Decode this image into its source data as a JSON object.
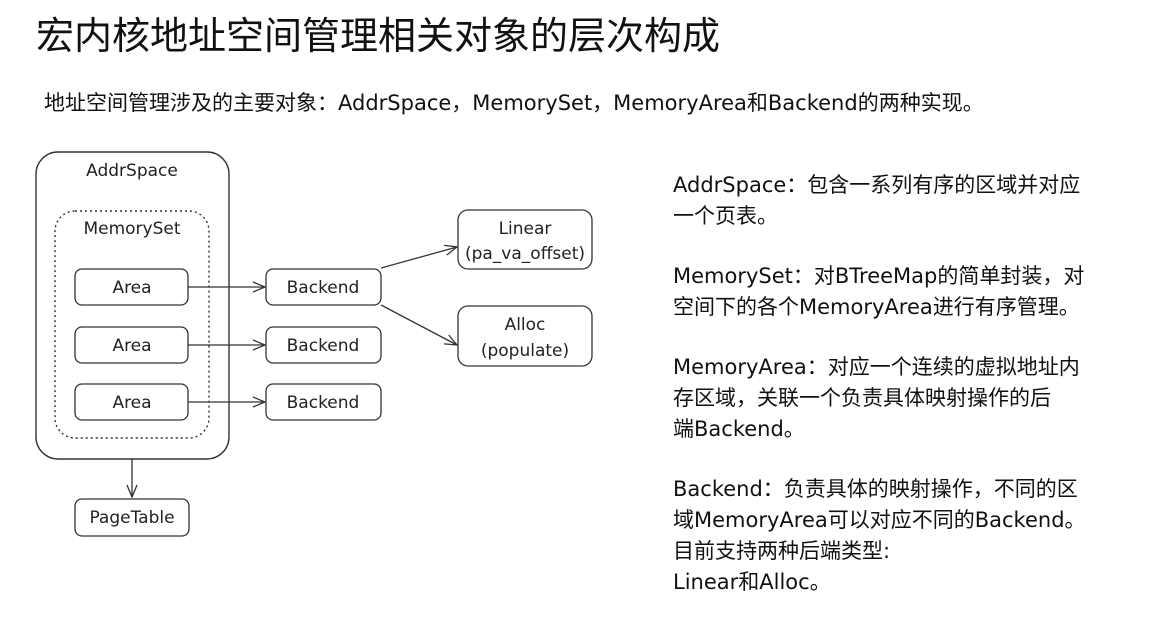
{
  "title": "宏内核地址空间管理相关对象的层次构成",
  "subtitle": "地址空间管理涉及的主要对象：AddrSpace，MemorySet，MemoryArea和Backend的两种实现。",
  "diagram": {
    "addrspace_label": "AddrSpace",
    "memoryset_label": "MemorySet",
    "areas": [
      "Area",
      "Area",
      "Area"
    ],
    "backends": [
      "Backend",
      "Backend",
      "Backend"
    ],
    "linear": {
      "line1": "Linear",
      "line2": "(pa_va_offset)"
    },
    "alloc": {
      "line1": "Alloc",
      "line2": "(populate)"
    },
    "pagetable_label": "PageTable"
  },
  "descriptions": [
    {
      "lines": [
        "AddrSpace：包含一系列有序的区域并对应",
        "一个页表。"
      ]
    },
    {
      "lines": [
        "MemorySet：对BTreeMap的简单封装，对",
        "空间下的各个MemoryArea进行有序管理。"
      ]
    },
    {
      "lines": [
        "MemoryArea：对应一个连续的虚拟地址内",
        "存区域，关联一个负责具体映射操作的后",
        "端Backend。"
      ]
    },
    {
      "lines": [
        "Backend：负责具体的映射操作，不同的区",
        "域MemoryArea可以对应不同的Backend。",
        "目前支持两种后端类型:",
        "Linear和Alloc。"
      ]
    }
  ],
  "colors": {
    "stroke": "#333333",
    "text": "#111111",
    "background": "#ffffff"
  }
}
